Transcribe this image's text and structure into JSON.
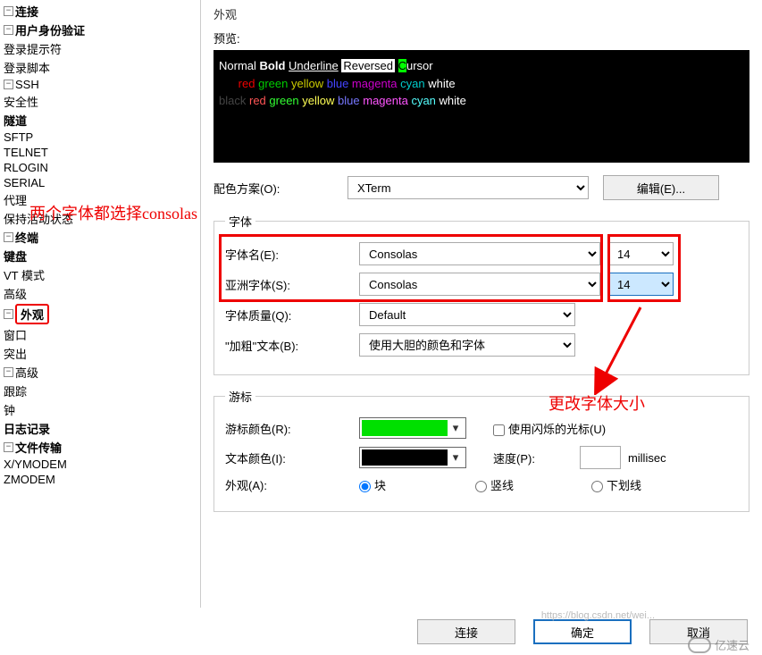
{
  "title": "外观",
  "annotations": {
    "font_note": "两个字体都选择consolas",
    "size_note": "更改字体大小"
  },
  "sidebar": {
    "connection": "连接",
    "auth": "用户身份验证",
    "login_prompt": "登录提示符",
    "login_script": "登录脚本",
    "ssh": "SSH",
    "security": "安全性",
    "tunnel": "隧道",
    "sftp": "SFTP",
    "telnet": "TELNET",
    "rlogin": "RLOGIN",
    "serial": "SERIAL",
    "proxy": "代理",
    "keepalive": "保持活动状态",
    "terminal": "终端",
    "keyboard": "键盘",
    "vt": "VT 模式",
    "advanced_t": "高级",
    "appearance": "外观",
    "window": "窗口",
    "highlight": "突出",
    "advanced": "高级",
    "trace": "跟踪",
    "bell": "钟",
    "logging": "日志记录",
    "file_transfer": "文件传输",
    "xymodem": "X/YMODEM",
    "zmodem": "ZMODEM"
  },
  "preview": {
    "label": "预览:",
    "normal": "Normal",
    "bold": "Bold",
    "underline": "Underline",
    "reversed": "Reversed",
    "cursor_c": "C",
    "cursor_rest": "ursor",
    "black": "black",
    "red": "red",
    "green": "green",
    "yellow": "yellow",
    "blue": "blue",
    "magenta": "magenta",
    "cyan": "cyan",
    "white": "white"
  },
  "scheme": {
    "label": "配色方案(O):",
    "value": "XTerm",
    "edit": "编辑(E)..."
  },
  "font_group": {
    "legend": "字体",
    "name_label": "字体名(E):",
    "name_value": "Consolas",
    "name_size": "14",
    "asia_label": "亚洲字体(S):",
    "asia_value": "Consolas",
    "asia_size": "14",
    "quality_label": "字体质量(Q):",
    "quality_value": "Default",
    "bold_label": "\"加粗\"文本(B):",
    "bold_value": "使用大胆的颜色和字体"
  },
  "cursor_group": {
    "legend": "游标",
    "cursor_color_label": "游标颜色(R):",
    "cursor_color": "#00e000",
    "text_color_label": "文本颜色(I):",
    "text_color": "#000000",
    "blink_label": "使用闪烁的光标(U)",
    "speed_label": "速度(P):",
    "speed_unit": "millisec",
    "appearance_label": "外观(A):",
    "opt_block": "块",
    "opt_vline": "竖线",
    "opt_underline": "下划线"
  },
  "footer": {
    "connect": "连接",
    "ok": "确定",
    "cancel": "取消"
  },
  "watermark": {
    "text": "亿速云",
    "url": "https://blog.csdn.net/wei..."
  }
}
